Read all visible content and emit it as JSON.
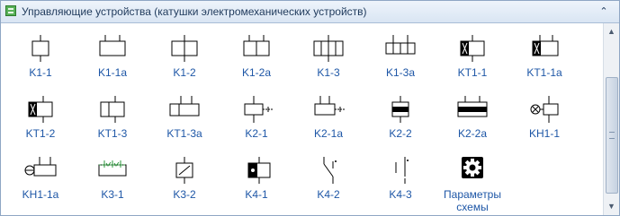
{
  "window": {
    "title": "Управляющие устройства (катушки электромеханических устройств)",
    "title_icon": "grid-icon",
    "collapse_icon": "chevron-up-icon"
  },
  "palette": {
    "items": [
      {
        "label": "K1-1",
        "symbol": "coil-basic"
      },
      {
        "label": "K1-1a",
        "symbol": "coil-wide"
      },
      {
        "label": "K1-2",
        "symbol": "coil-double"
      },
      {
        "label": "K1-2a",
        "symbol": "coil-double-wide"
      },
      {
        "label": "K1-3",
        "symbol": "coil-triple"
      },
      {
        "label": "K1-3a",
        "symbol": "coil-triple-wide"
      },
      {
        "label": "KT1-1",
        "symbol": "timer-coil"
      },
      {
        "label": "KT1-1a",
        "symbol": "timer-coil-wide"
      },
      {
        "label": "KT1-2",
        "symbol": "timer-coil-2"
      },
      {
        "label": "KT1-3",
        "symbol": "timer-coil-3"
      },
      {
        "label": "KT1-3a",
        "symbol": "timer-coil-3a"
      },
      {
        "label": "K2-1",
        "symbol": "coil-arrow"
      },
      {
        "label": "K2-1a",
        "symbol": "coil-arrow-wide"
      },
      {
        "label": "K2-2",
        "symbol": "coil-bar"
      },
      {
        "label": "K2-2a",
        "symbol": "coil-bar-wide"
      },
      {
        "label": "KH1-1",
        "symbol": "coil-circle"
      },
      {
        "label": "KH1-1a",
        "symbol": "coil-circle-wide"
      },
      {
        "label": "K3-1",
        "symbol": "coil-green"
      },
      {
        "label": "K3-2",
        "symbol": "coil-slash"
      },
      {
        "label": "K4-1",
        "symbol": "coil-black"
      },
      {
        "label": "K4-2",
        "symbol": "switch-1"
      },
      {
        "label": "K4-3",
        "symbol": "switch-2"
      },
      {
        "label": "Параметры\nсхемы",
        "symbol": "gear"
      }
    ]
  },
  "colors": {
    "label": "#1d56a6",
    "line": "#000000",
    "accent_green": "#2e9a3e",
    "title_text": "#1e395b"
  }
}
